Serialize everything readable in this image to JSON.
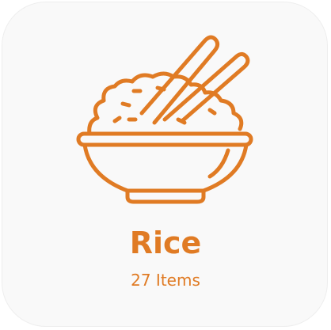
{
  "category": {
    "icon": "rice-bowl-icon",
    "title": "Rice",
    "count_label": "27 Items"
  },
  "colors": {
    "accent": "#e07b24",
    "card_background": "#f9f9f9",
    "card_border": "#eeeeee"
  }
}
